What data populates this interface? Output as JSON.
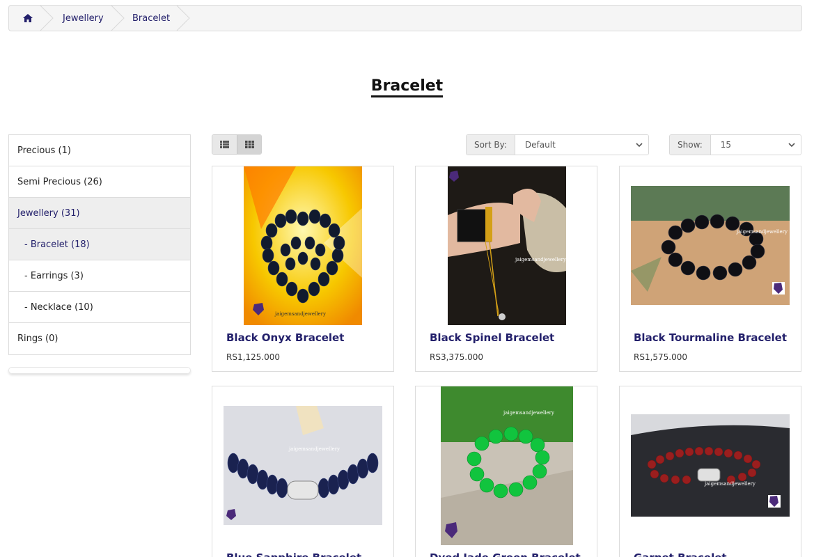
{
  "breadcrumb": {
    "home_icon": "home-icon",
    "items": [
      {
        "label": "Jewellery"
      },
      {
        "label": "Bracelet"
      }
    ]
  },
  "page_title": "Bracelet",
  "categories": [
    {
      "label": "Precious (1)",
      "active": false
    },
    {
      "label": "Semi Precious (26)",
      "active": false
    },
    {
      "label": "Jewellery (31)",
      "active": true
    },
    {
      "label": "- Bracelet (18)",
      "active": true
    },
    {
      "label": "- Earrings (3)",
      "active": false
    },
    {
      "label": "- Necklace (10)",
      "active": false
    },
    {
      "label": "Rings (0)",
      "active": false
    }
  ],
  "toolbar": {
    "list_view_icon": "list-view-icon",
    "grid_view_icon": "grid-view-icon",
    "sort_label": "Sort By:",
    "sort_value": "Default",
    "show_label": "Show:",
    "show_value": "15"
  },
  "products": [
    {
      "name": "Black Onyx Bracelet",
      "price": "RS1,125.000"
    },
    {
      "name": "Black Spinel Bracelet",
      "price": "RS3,375.000"
    },
    {
      "name": "Black Tourmaline Bracelet",
      "price": "RS1,575.000"
    },
    {
      "name": "Blue Sapphire Bracelet",
      "price": ""
    },
    {
      "name": "Dyed Jade Green Bracelet",
      "price": ""
    },
    {
      "name": "Garnet Bracelet",
      "price": ""
    }
  ],
  "watermark": "jaigemsandjewellery",
  "colors": {
    "link": "#23206b",
    "active_bg": "#eeeeee",
    "brand_purple": "#4b2a7a"
  }
}
